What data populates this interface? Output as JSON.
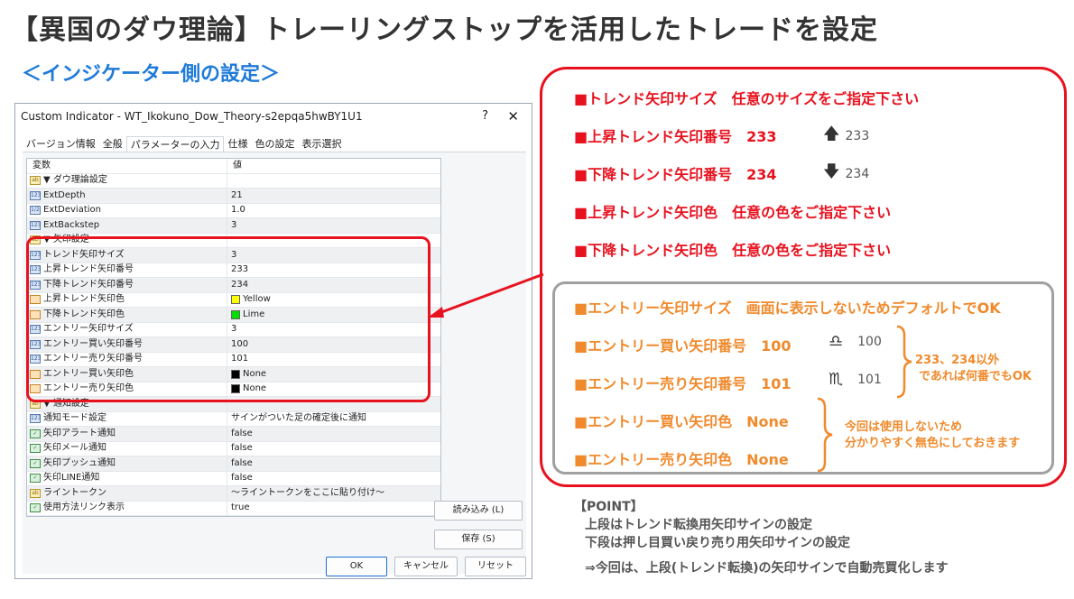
{
  "page": {
    "title": "【異国のダウ理論】トレーリングストップを活用したトレードを設定",
    "section": "＜インジケーター側の設定＞"
  },
  "dialog": {
    "title": "Custom Indicator - WT_Ikokuno_Dow_Theory-s2epqa5hwBY1U1",
    "help": "?",
    "close": "✕",
    "tabs": [
      "バージョン情報",
      "全般",
      "パラメーターの入力",
      "仕様",
      "色の設定",
      "表示選択"
    ],
    "active_tab": 2,
    "columns": {
      "name": "変数",
      "value": "値"
    },
    "rows": [
      {
        "icon": "ab",
        "name": "▼ ダウ理論設定",
        "value": ""
      },
      {
        "icon": "123",
        "name": "ExtDepth",
        "value": "21"
      },
      {
        "icon": "1/2",
        "name": "ExtDeviation",
        "value": "1.0"
      },
      {
        "icon": "123",
        "name": "ExtBackstep",
        "value": "3"
      },
      {
        "icon": "ab",
        "name": "▼ 矢印設定",
        "value": ""
      },
      {
        "icon": "123",
        "name": "トレンド矢印サイズ",
        "value": "3"
      },
      {
        "icon": "123",
        "name": "上昇トレンド矢印番号",
        "value": "233"
      },
      {
        "icon": "123",
        "name": "下降トレンド矢印番号",
        "value": "234"
      },
      {
        "icon": "col",
        "name": "上昇トレンド矢印色",
        "value": "Yellow",
        "swatch": "#ffff00"
      },
      {
        "icon": "col",
        "name": "下降トレンド矢印色",
        "value": "Lime",
        "swatch": "#00e000"
      },
      {
        "icon": "123",
        "name": "エントリー矢印サイズ",
        "value": "3"
      },
      {
        "icon": "123",
        "name": "エントリー買い矢印番号",
        "value": "100"
      },
      {
        "icon": "123",
        "name": "エントリー売り矢印番号",
        "value": "101"
      },
      {
        "icon": "col",
        "name": "エントリー買い矢印色",
        "value": "None",
        "swatch": "#000000"
      },
      {
        "icon": "col",
        "name": "エントリー売り矢印色",
        "value": "None",
        "swatch": "#000000"
      },
      {
        "icon": "ab",
        "name": "▼ 通知設定",
        "value": ""
      },
      {
        "icon": "123",
        "name": "通知モード設定",
        "value": "サインがついた足の確定後に通知"
      },
      {
        "icon": "bool",
        "name": "矢印アラート通知",
        "value": "false"
      },
      {
        "icon": "bool",
        "name": "矢印メール通知",
        "value": "false"
      },
      {
        "icon": "bool",
        "name": "矢印プッシュ通知",
        "value": "false"
      },
      {
        "icon": "bool",
        "name": "矢印LINE通知",
        "value": "false"
      },
      {
        "icon": "ab",
        "name": "ライントークン",
        "value": "～ライントークンをここに貼り付け～"
      },
      {
        "icon": "bool",
        "name": "使用方法リンク表示",
        "value": "true"
      }
    ],
    "buttons": {
      "load": "読み込み (L)",
      "save": "保存 (S)",
      "ok": "OK",
      "cancel": "キャンセル",
      "reset": "リセット"
    }
  },
  "annotations": {
    "trend_size": "■トレンド矢印サイズ　任意のサイズをご指定下さい",
    "up_number": "■上昇トレンド矢印番号　233",
    "up_icon_value": "233",
    "down_number": "■下降トレンド矢印番号　234",
    "down_icon_value": "234",
    "up_color": "■上昇トレンド矢印色　任意の色をご指定下さい",
    "down_color": "■下降トレンド矢印色　任意の色をご指定下さい",
    "entry_size": "■エントリー矢印サイズ　画面に表示しないためデフォルトでOK",
    "buy_number": "■エントリー買い矢印番号　100",
    "buy_icon_value": "100",
    "sell_number": "■エントリー売り矢印番号　101",
    "sell_icon_value": "101",
    "number_note_1": "233、234以外",
    "number_note_2": "であれば何番でもOK",
    "buy_color": "■エントリー買い矢印色　None",
    "sell_color": "■エントリー売り矢印色　None",
    "color_note_1": "今回は使用しないため",
    "color_note_2": "分かりやすく無色にしておきます"
  },
  "point": {
    "heading": "【POINT】",
    "line1": "上段はトレンド転換用矢印サインの設定",
    "line2": "下段は押し目買い戻り売り用矢印サインの設定",
    "line3": "⇒今回は、上段(トレンド転換)の矢印サインで自動売買化します"
  },
  "colors": {
    "accent_red": "#e8121f",
    "accent_orange": "#f08a2c",
    "accent_blue": "#1f7ad8"
  }
}
